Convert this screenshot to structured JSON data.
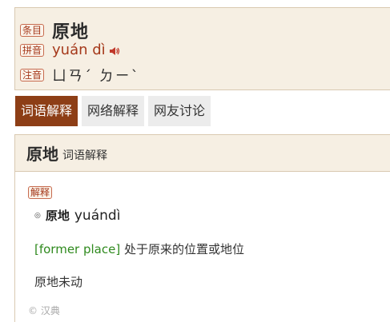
{
  "header": {
    "entry_tag": "条目",
    "word": "原地",
    "pinyin_tag": "拼音",
    "pinyin": "yuán dì",
    "zhuyin_tag": "注音",
    "zhuyin": "ㄩㄢˊ ㄉㄧˋ"
  },
  "tabs": [
    {
      "label": "词语解释",
      "active": true
    },
    {
      "label": "网络解释",
      "active": false
    },
    {
      "label": "网友讨论",
      "active": false
    }
  ],
  "panel": {
    "word": "原地",
    "subtitle": "词语解释",
    "explain_tag": "解释",
    "bullet": "◎",
    "entry_word": "原地",
    "entry_pinyin": "yuándì",
    "english": "[former place]",
    "definition": "处于原来的位置或地位",
    "example": "原地未动",
    "copyright": "© 汉典"
  },
  "colors": {
    "accent": "#8d3e16",
    "tag_text": "#a5391b",
    "header_bg": "#f6efe3",
    "english_green": "#2f8a1e"
  }
}
